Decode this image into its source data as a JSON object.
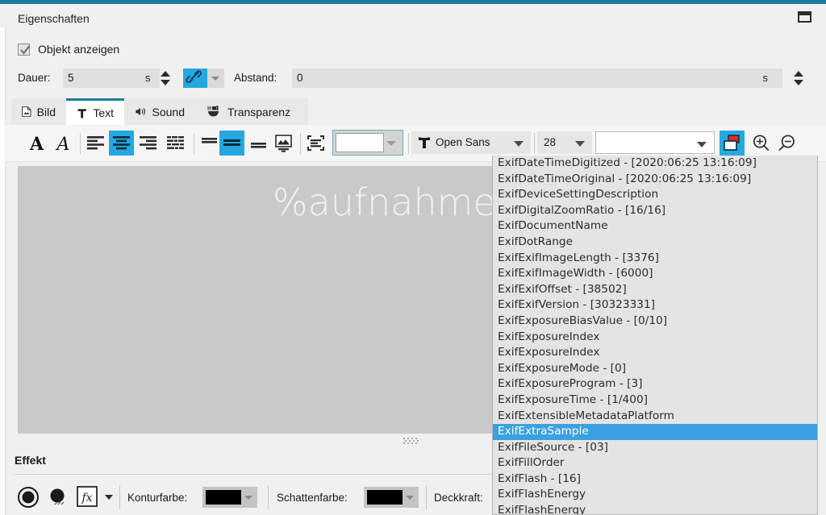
{
  "window": {
    "title": "Eigenschaften",
    "restore_icon": "restore-window-icon",
    "accent_color": "#1b7c9e"
  },
  "object_visible": {
    "label": "Objekt anzeigen",
    "checked": true,
    "check_icon": "checkmark-icon"
  },
  "duration_row": {
    "duration_label": "Dauer:",
    "duration_value": "5",
    "duration_unit": "s",
    "link_icon": "chain-link-icon",
    "gap_label": "Abstand:",
    "gap_value": "0",
    "gap_unit": "s",
    "spinner_icon": "spinner-updown-icon"
  },
  "tabs": [
    {
      "label": "Bild",
      "icon": "image-file-icon",
      "active": false
    },
    {
      "label": "Text",
      "icon": "text-t-icon",
      "active": true
    },
    {
      "label": "Sound",
      "icon": "speaker-icon",
      "active": false
    },
    {
      "label": "Transparenz",
      "icon": "transparency-icon",
      "active": false
    }
  ],
  "toolbar": {
    "bold_icon": "bold-A-icon",
    "italic_icon": "italic-A-icon",
    "align_left_icon": "align-left-icon",
    "align_center_icon": "align-center-icon",
    "align_right_icon": "align-right-icon",
    "align_justify_icon": "align-justify-icon",
    "valign_top_icon": "vertical-align-top-icon",
    "valign_middle_icon": "vertical-align-middle-icon",
    "valign_bottom_icon": "vertical-align-bottom-icon",
    "text_over_image_icon": "text-over-image-icon",
    "fit_text_icon": "fit-text-to-frame-icon",
    "color_swatch": "#ffffff",
    "font_icon": "font-glyph-icon",
    "font_name": "Open Sans",
    "font_size": "28",
    "variable_value": "",
    "insert_variable_icon": "insert-placeholder-icon",
    "zoom_in_icon": "zoom-in-icon",
    "zoom_out_icon": "zoom-out-icon",
    "active_color": "#25a8e0"
  },
  "preview": {
    "text": "%aufnahmeda",
    "grip_icon": "resize-grip-icon",
    "background": "#c9c9c9"
  },
  "effect": {
    "title": "Effekt",
    "outline_icon": "outline-effect-icon",
    "shadow_icon": "shadow-effect-icon",
    "fx_icon": "fx-icon",
    "dropdown_caret_icon": "chevron-down-icon",
    "outline_color_label": "Konturfarbe:",
    "outline_color": "#000000",
    "shadow_color_label": "Schattenfarbe:",
    "shadow_color": "#000000",
    "opacity_label": "Deckkraft:"
  },
  "dropdown": {
    "selected_index": 17,
    "items": [
      "ExifDateTimeDigitized  -  [2020:06:25 13:16:09]",
      "ExifDateTimeOriginal  -  [2020:06:25 13:16:09]",
      "ExifDeviceSettingDescription",
      "ExifDigitalZoomRatio  -  [16/16]",
      "ExifDocumentName",
      "ExifDotRange",
      "ExifExifImageLength  -  [3376]",
      "ExifExifImageWidth  -  [6000]",
      "ExifExifOffset  -  [38502]",
      "ExifExifVersion  -  [30323331]",
      "ExifExposureBiasValue  -  [0/10]",
      "ExifExposureIndex",
      "ExifExposureIndex",
      "ExifExposureMode  -  [0]",
      "ExifExposureProgram  -  [3]",
      "ExifExposureTime  -  [1/400]",
      "ExifExtensibleMetadataPlatform",
      "ExifExtraSample",
      "ExifFileSource  -  [03]",
      "ExifFillOrder",
      "ExifFlash  -  [16]",
      "ExifFlashEnergy",
      "ExifFlashEnergy"
    ]
  }
}
